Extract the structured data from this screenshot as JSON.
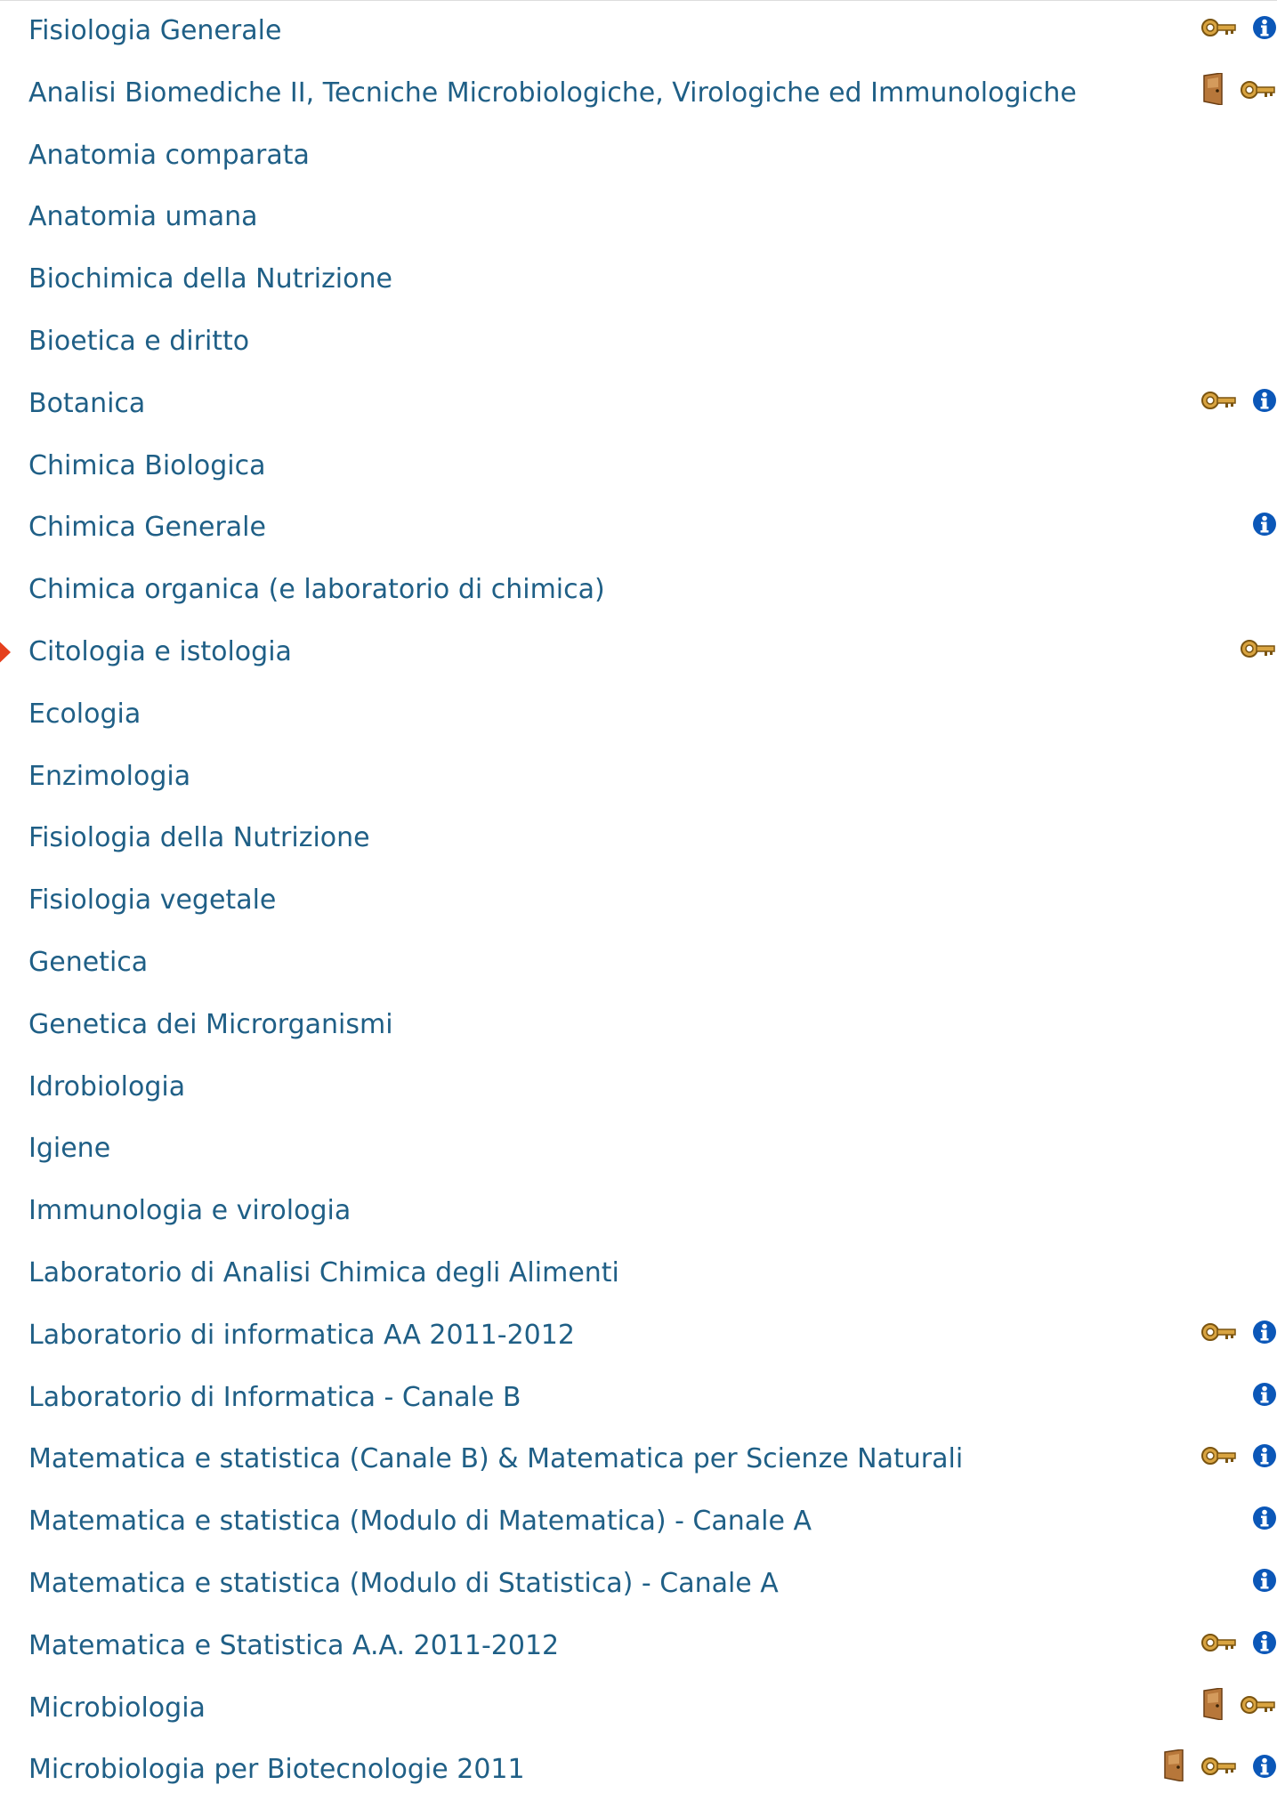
{
  "courses": [
    {
      "name": "Fisiologia Generale",
      "icons": [
        "key-icon",
        "info-icon"
      ]
    },
    {
      "name": "Analisi Biomediche II, Tecniche Microbiologiche, Virologiche ed Immunologiche",
      "icons": [
        "door-icon",
        "key-icon"
      ]
    },
    {
      "name": "Anatomia comparata",
      "icons": []
    },
    {
      "name": "Anatomia umana",
      "icons": []
    },
    {
      "name": "Biochimica della Nutrizione",
      "icons": []
    },
    {
      "name": "Bioetica e diritto",
      "icons": []
    },
    {
      "name": "Botanica",
      "icons": [
        "key-icon",
        "info-icon"
      ]
    },
    {
      "name": "Chimica Biologica",
      "icons": []
    },
    {
      "name": "Chimica Generale",
      "icons": [
        "info-icon"
      ]
    },
    {
      "name": "Chimica organica (e laboratorio di chimica)",
      "icons": []
    },
    {
      "name": "Citologia e istologia",
      "icons": [
        "key-icon"
      ]
    },
    {
      "name": "Ecologia",
      "icons": []
    },
    {
      "name": "Enzimologia",
      "icons": []
    },
    {
      "name": "Fisiologia della Nutrizione",
      "icons": []
    },
    {
      "name": "Fisiologia vegetale",
      "icons": []
    },
    {
      "name": "Genetica",
      "icons": []
    },
    {
      "name": "Genetica dei Microrganismi",
      "icons": []
    },
    {
      "name": "Idrobiologia",
      "icons": []
    },
    {
      "name": "Igiene",
      "icons": []
    },
    {
      "name": "Immunologia e virologia",
      "icons": []
    },
    {
      "name": "Laboratorio di Analisi Chimica degli Alimenti",
      "icons": []
    },
    {
      "name": "Laboratorio di informatica AA 2011-2012",
      "icons": [
        "key-icon",
        "info-icon"
      ]
    },
    {
      "name": "Laboratorio di Informatica - Canale B",
      "icons": [
        "info-icon"
      ]
    },
    {
      "name": "Matematica e statistica (Canale B) & Matematica per Scienze Naturali",
      "icons": [
        "key-icon",
        "info-icon"
      ]
    },
    {
      "name": "Matematica e statistica (Modulo di Matematica) - Canale A",
      "icons": [
        "info-icon"
      ]
    },
    {
      "name": "Matematica e statistica (Modulo di Statistica) - Canale A",
      "icons": [
        "info-icon"
      ]
    },
    {
      "name": "Matematica e Statistica A.A. 2011-2012",
      "icons": [
        "key-icon",
        "info-icon"
      ]
    },
    {
      "name": "Microbiologia",
      "icons": [
        "door-icon",
        "key-icon"
      ]
    },
    {
      "name": "Microbiologia per Biotecnologie 2011",
      "icons": [
        "door-icon",
        "key-icon",
        "info-icon"
      ]
    }
  ],
  "colors": {
    "link": "#1f5f86",
    "info_icon": "#0b57b8",
    "key_icon": "#d9a441",
    "door_icon": "#b7773a",
    "pointer_arrow": "#e5401d"
  }
}
